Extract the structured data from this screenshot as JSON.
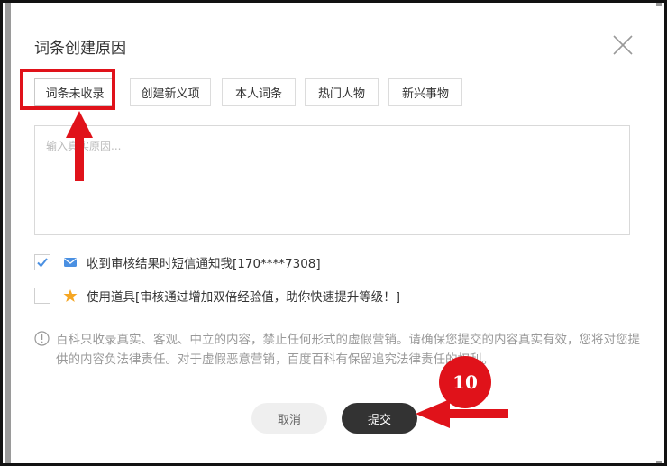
{
  "dialog": {
    "title": "词条创建原因",
    "close_icon": "close-icon"
  },
  "tags": [
    {
      "label": "词条未收录",
      "selected": true
    },
    {
      "label": "创建新义项"
    },
    {
      "label": "本人词条"
    },
    {
      "label": "热门人物"
    },
    {
      "label": "新兴事物"
    }
  ],
  "reason_input": {
    "placeholder": "输入真实原因...",
    "value": ""
  },
  "options": [
    {
      "label": "收到审核结果时短信通知我[170****7308]",
      "checked": true,
      "icon": "mail-icon",
      "icon_color": "#4a90e2"
    },
    {
      "label": "使用道具[审核通过增加双倍经验值，助你快速提升等级！]",
      "checked": false,
      "icon": "star-icon",
      "icon_color": "#f5a623"
    }
  ],
  "notice": {
    "icon": "info-circle-icon",
    "text": "百科只收录真实、客观、中立的内容，禁止任何形式的虚假营销。请确保您提交的内容真实有效，您将对您提供的内容负法律责任。对于虚假恶意营销，百度百科有保留追究法律责任的权利。"
  },
  "buttons": {
    "cancel": "取消",
    "submit": "提交"
  },
  "annotations": {
    "step_number": "10",
    "highlight_color": "#e0121a"
  }
}
